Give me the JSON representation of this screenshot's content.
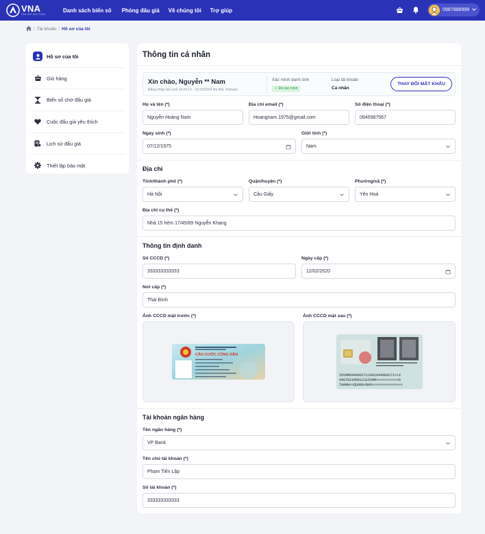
{
  "header": {
    "logo_text": "VNA",
    "logo_sub": "ONLINE AUCTION",
    "nav": [
      "Danh sách biển số",
      "Phòng đấu giá",
      "Về chúng tôi",
      "Trợ giúp"
    ],
    "phone": "0987888999"
  },
  "breadcrumb": {
    "items": [
      "Tài khoản",
      "Hồ sơ của tôi"
    ],
    "separator": "/"
  },
  "sidebar": {
    "items": [
      {
        "label": "Hồ sơ của tôi",
        "icon": "user-icon"
      },
      {
        "label": "Giỏ hàng",
        "icon": "basket-icon"
      },
      {
        "label": "Biển số chờ đấu giá",
        "icon": "hourglass-icon"
      },
      {
        "label": "Cuộc đấu giá yêu thích",
        "icon": "heart-icon"
      },
      {
        "label": "Lịch sử đấu giá",
        "icon": "history-icon"
      },
      {
        "label": "Thiết lập bảo mật",
        "icon": "gear-icon"
      }
    ]
  },
  "main": {
    "title": "Thông tin cá nhân",
    "greeting": {
      "name": "Xin chào, Nguyễn ** Nam",
      "last_login": "Đăng nhập lần cuối 14:24:12 - 21/10/2024 Hà Nội, Vietnam",
      "verify_label": "Xác minh danh tính",
      "verify_badge": "✓ Đã xác minh",
      "account_type_label": "Loại tài khoản",
      "account_type_value": "Cá nhân",
      "change_password": "THAY ĐỔI MẬT KHẨU"
    },
    "personal": {
      "full_name_label": "Họ và tên (*)",
      "full_name": "Nguyễn Hoàng Nam",
      "email_label": "Địa chỉ email (*)",
      "email": "Hoangnam.1975@gmail.com",
      "phone_label": "Số điện thoại (*)",
      "phone": "0945987567",
      "dob_label": "Ngày sinh (*)",
      "dob": "07/12/1975",
      "gender_label": "Giới tính (*)",
      "gender": "Nam"
    },
    "address": {
      "title": "Địa chỉ",
      "province_label": "Tỉnh/thành phố (*)",
      "province": "Hà Nội",
      "district_label": "Quận/huyện (*)",
      "district": "Cầu Giấy",
      "ward_label": "Phường/xã (*)",
      "ward": "Yên Hoà",
      "detail_label": "Địa chỉ cụ thể (*)",
      "detail": "Nhà 15 hẻm 17/45/89 Nguyễn Khang"
    },
    "identity": {
      "title": "Thông tin định danh",
      "cccd_label": "Số CCCD (*)",
      "cccd": "333333333333",
      "issue_date_label": "Ngày cấp (*)",
      "issue_date": "12/02/2020",
      "issue_place_label": "Nơi cấp (*)",
      "issue_place": "Thái Bình",
      "front_label": "Ảnh CCCD mặt trước (*)",
      "back_label": "Ảnh CCCD mặt sau (*)",
      "front_card_heading": "CĂN CƯỚC CÔNG DÂN",
      "back_mrz_1": "IDVNM0440092711001044009271<<2",
      "back_mrz_2": "4407021M9912315VNM<<<<<<<<<<<6",
      "back_mrz_3": "THANH<<QUANG<BAO<<<<<<<<<<<<<<<"
    },
    "bank": {
      "title": "Tài khoản ngân hàng",
      "bank_name_label": "Tên ngân hàng (*)",
      "bank_name": "VP Bank",
      "holder_label": "Tên chủ tài khoản (*)",
      "holder": "Phạm Tiến Lập",
      "account_no_label": "Số tài khoản (*)",
      "account_no": "333333333333"
    }
  },
  "colors": {
    "primary": "#2a32b8",
    "verified_bg": "#d9f3df",
    "verified_text": "#2b9a47"
  }
}
